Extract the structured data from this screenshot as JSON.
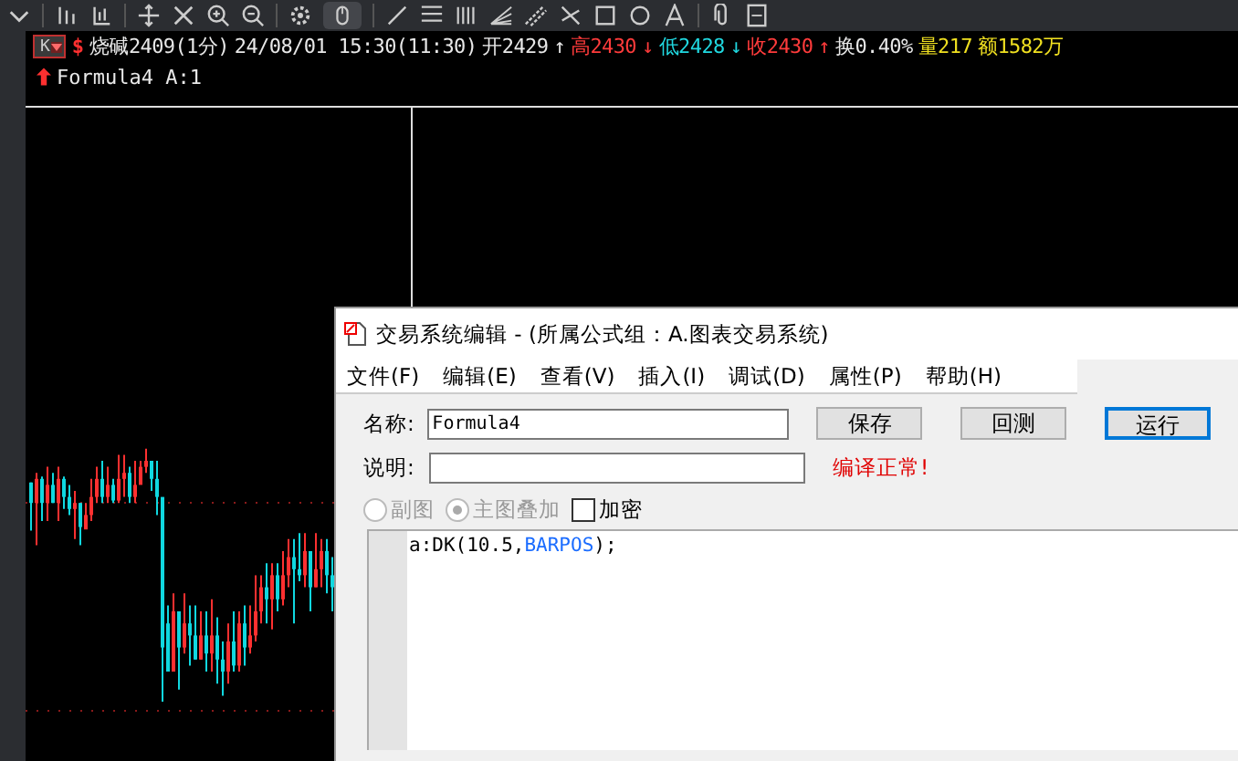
{
  "toolbar": {
    "period_badge": "K",
    "currency_mark": "$"
  },
  "quote": [
    {
      "text": "烧碱2409(1分)",
      "color": "#e8e8e8"
    },
    {
      "text": "24/08/01 15:30(11:30)",
      "color": "#e8e8e8"
    },
    {
      "text": "开2429",
      "color": "#e8e8e8"
    },
    {
      "text": "↑",
      "color": "#e8e8e8"
    },
    {
      "text": "高2430",
      "color": "#ff3b3b"
    },
    {
      "text": "↓",
      "color": "#ff3b3b"
    },
    {
      "text": "低2428",
      "color": "#20d8e0"
    },
    {
      "text": "↓",
      "color": "#20d8e0"
    },
    {
      "text": "收2430",
      "color": "#ff3b3b"
    },
    {
      "text": "↑",
      "color": "#ff3b3b"
    },
    {
      "text": "换0.40%",
      "color": "#e8e8e8"
    },
    {
      "text": "量217",
      "color": "#f0e020"
    },
    {
      "text": "额1582万",
      "color": "#f0e020"
    }
  ],
  "indicator": {
    "text": "Formula4 A:1"
  },
  "dialog": {
    "title": "交易系统编辑 - (所属公式组：A.图表交易系统)",
    "menu": [
      "文件(F)",
      "编辑(E)",
      "查看(V)",
      "插入(I)",
      "调试(D)",
      "属性(P)",
      "帮助(H)"
    ],
    "name_label": "名称:",
    "name_value": "Formula4",
    "buttons": [
      {
        "label": "保存",
        "focused": false
      },
      {
        "label": "回测",
        "focused": false
      },
      {
        "label": "运行",
        "focused": true
      }
    ],
    "desc_label": "说明:",
    "status": "编译正常!",
    "options": [
      {
        "kind": "radio",
        "label": "副图",
        "selected": false,
        "disabled": true
      },
      {
        "kind": "radio",
        "label": "主图叠加",
        "selected": true,
        "disabled": true
      },
      {
        "kind": "checkbox",
        "label": "加密",
        "checked": false,
        "disabled": false
      }
    ],
    "code": [
      {
        "kind": "plain",
        "text": "a:DK(10.5,"
      },
      {
        "kind": "keyword",
        "text": "BARPOS"
      },
      {
        "kind": "plain",
        "text": ");"
      }
    ]
  }
}
